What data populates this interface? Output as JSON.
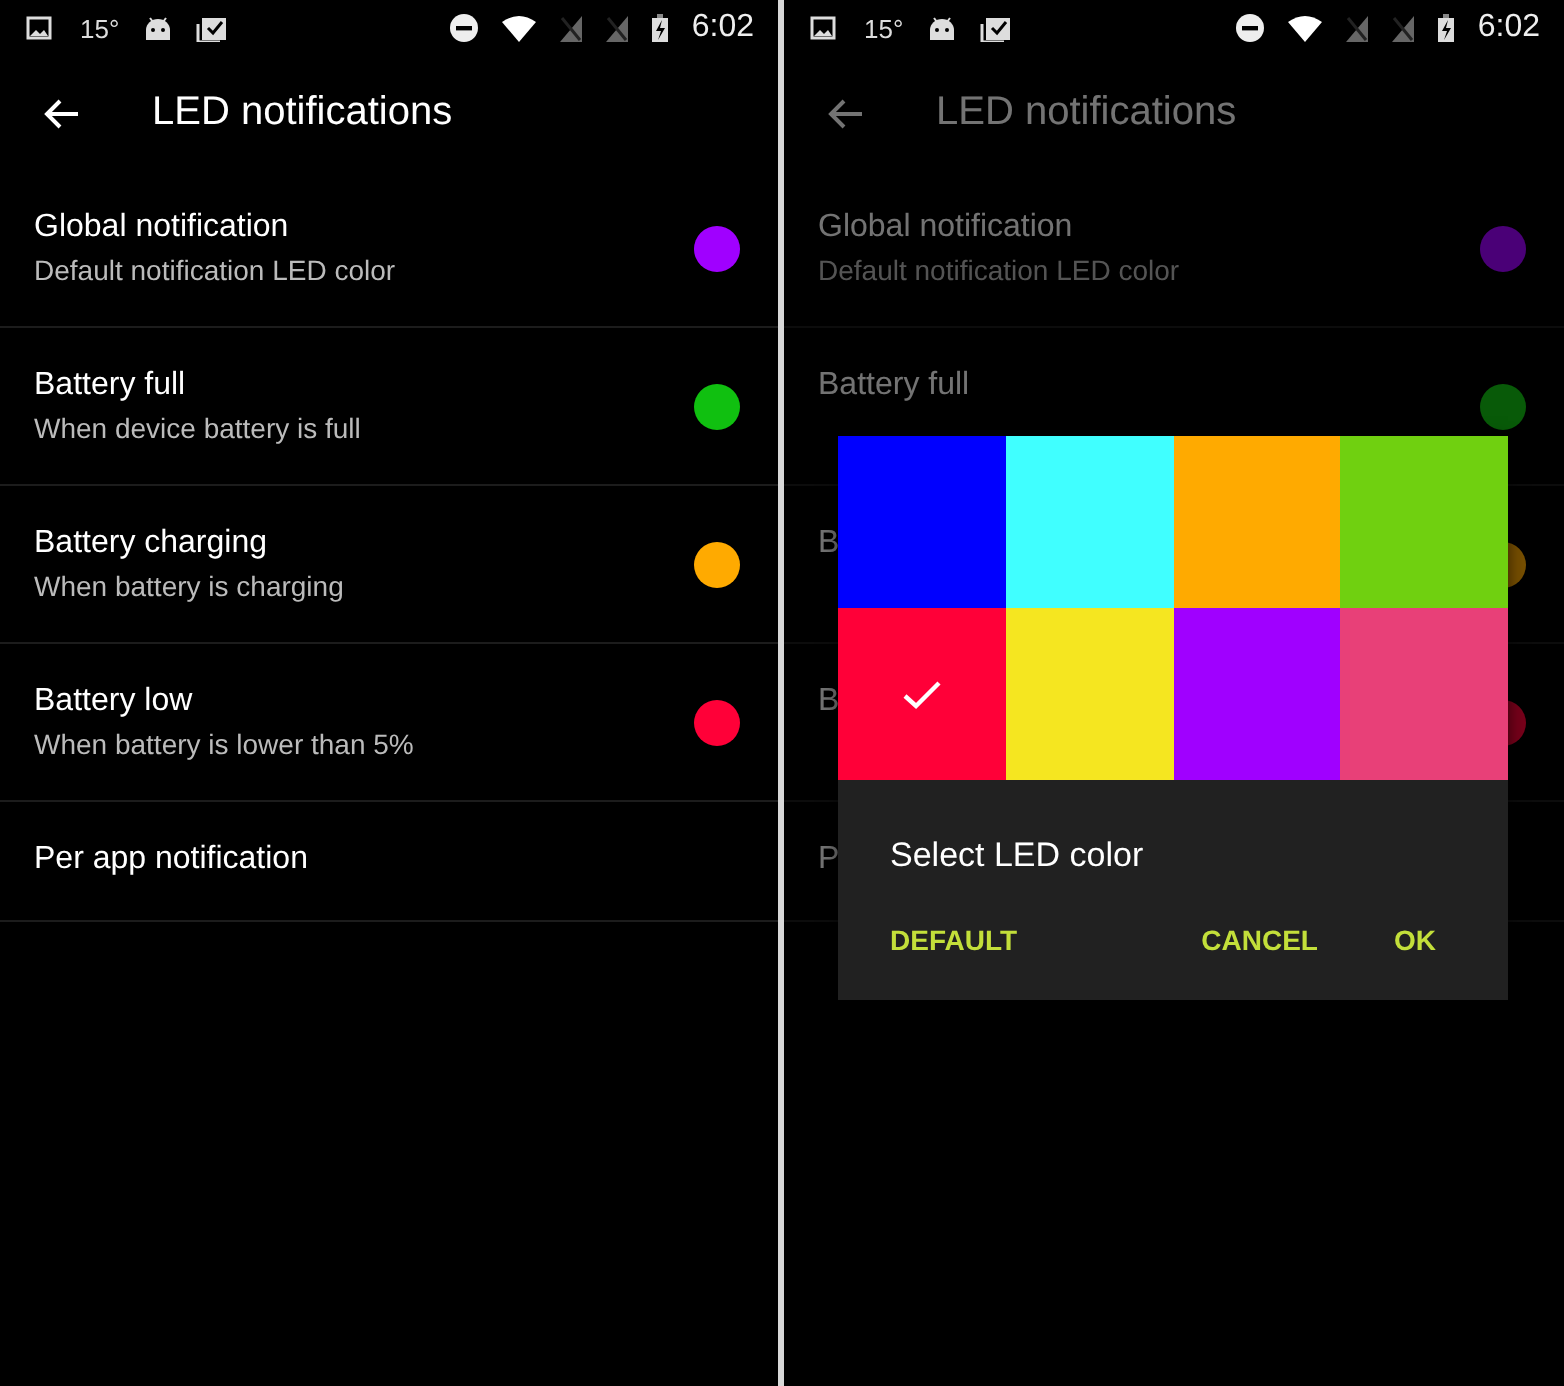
{
  "screens": [
    {
      "status_bar": {
        "temperature": "15°",
        "time": "6:02"
      },
      "title": "LED notifications",
      "dimmed": false,
      "settings": [
        {
          "title": "Global notification",
          "subtitle": "Default notification LED color",
          "color": "#a000ff"
        },
        {
          "title": "Battery full",
          "subtitle": "When device battery is full",
          "color": "#10c010"
        },
        {
          "title": "Battery charging",
          "subtitle": "When battery is charging",
          "color": "#ffaa00"
        },
        {
          "title": "Battery low",
          "subtitle": "When battery is lower than 5%",
          "color": "#ff0038"
        },
        {
          "title": "Per app notification"
        }
      ]
    },
    {
      "status_bar": {
        "temperature": "15°",
        "time": "6:02"
      },
      "title": "LED notifications",
      "dimmed": true,
      "settings": [
        {
          "title": "Global notification",
          "subtitle": "Default notification LED color",
          "color": "#4a0077"
        },
        {
          "title": "Battery full",
          "color": "#085a08"
        },
        {
          "title": "B",
          "color": "#774f00"
        },
        {
          "title": "B",
          "color": "#77001a"
        },
        {
          "title": "P"
        }
      ],
      "dialog": {
        "swatches": [
          {
            "color": "#0000ff",
            "selected": false
          },
          {
            "color": "#40ffff",
            "selected": false
          },
          {
            "color": "#ffaa00",
            "selected": false
          },
          {
            "color": "#70d010",
            "selected": false
          },
          {
            "color": "#ff0038",
            "selected": true
          },
          {
            "color": "#f5e620",
            "selected": false
          },
          {
            "color": "#a000ff",
            "selected": false
          },
          {
            "color": "#e84078",
            "selected": false
          }
        ],
        "title": "Select LED color",
        "buttons": [
          "DEFAULT",
          "CANCEL",
          "OK"
        ]
      }
    }
  ]
}
